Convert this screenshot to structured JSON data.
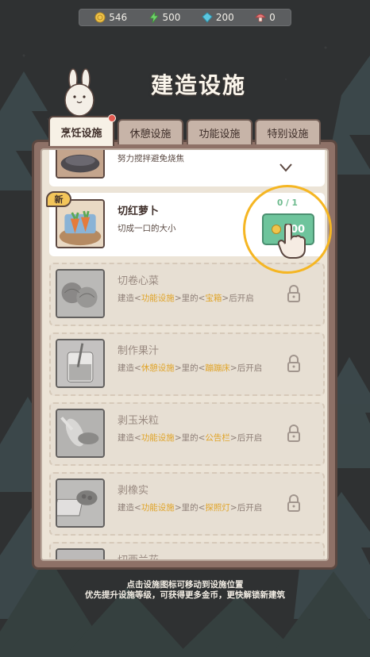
{
  "resources": [
    {
      "icon": "coin-icon",
      "value": "546",
      "color": "#f0c54c"
    },
    {
      "icon": "lightning-icon",
      "value": "500",
      "color": "#6fd36a"
    },
    {
      "icon": "gem-icon",
      "value": "200",
      "color": "#5bc6df"
    },
    {
      "icon": "mushroom-icon",
      "value": "0",
      "color": "#e77a7a"
    }
  ],
  "title": "建造设施",
  "tabs": [
    {
      "label": "烹饪设施",
      "active": true,
      "notification": true
    },
    {
      "label": "休憩设施",
      "active": false
    },
    {
      "label": "功能设施",
      "active": false
    },
    {
      "label": "特别设施",
      "active": false
    }
  ],
  "facilities": {
    "partial_top": {
      "desc": "努力搅拌避免烧焦"
    },
    "carrot": {
      "badge": "新",
      "name": "切红萝卜",
      "desc": "切成一口的大小",
      "progress": "0 / 1",
      "cost": "100"
    },
    "cabbage": {
      "name": "切卷心菜",
      "desc_pre": "建造<",
      "desc_hl1": "功能设施",
      "desc_mid": ">里的<",
      "desc_hl2": "宝箱",
      "desc_post": ">后开启"
    },
    "juice": {
      "name": "制作果汁",
      "desc_pre": "建造<",
      "desc_hl1": "休憩设施",
      "desc_mid": ">里的<",
      "desc_hl2": "蹦蹦床",
      "desc_post": ">后开启"
    },
    "corn": {
      "name": "剥玉米粒",
      "desc_pre": "建造<",
      "desc_hl1": "功能设施",
      "desc_mid": ">里的<",
      "desc_hl2": "公告栏",
      "desc_post": ">后开启"
    },
    "acorn": {
      "name": "剥橡实",
      "desc_pre": "建造<",
      "desc_hl1": "功能设施",
      "desc_mid": ">里的<",
      "desc_hl2": "探照灯",
      "desc_post": ">后开启"
    },
    "partial_bottom": {
      "name": "切西兰花"
    }
  },
  "footer": {
    "line1": "点击设施图标可移动到设施位置",
    "line2": "优先提升设施等级，可获得更多金币，更快解锁新建筑"
  },
  "colors": {
    "accent_gold": "#e0a429",
    "build_green": "#6ec49c",
    "highlight": "#f5b623"
  }
}
